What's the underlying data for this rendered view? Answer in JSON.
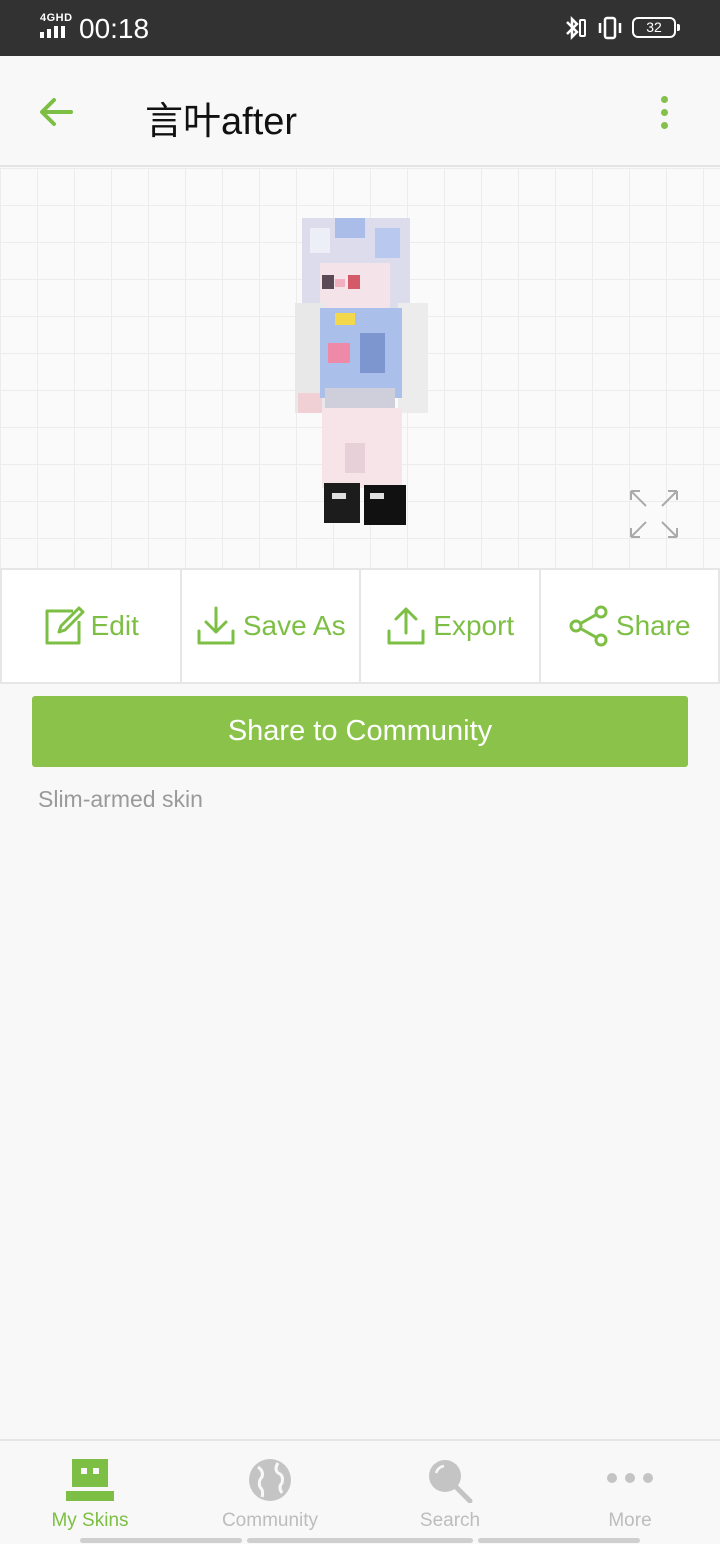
{
  "status_bar": {
    "network": "4GHD",
    "time": "00:18",
    "battery": "32",
    "icons": [
      "signal-icon",
      "bluetooth-icon",
      "vibrate-icon",
      "battery-icon"
    ]
  },
  "header": {
    "title": "言叶after",
    "back_icon": "arrow-left-icon",
    "menu_icon": "more-vertical-icon"
  },
  "preview": {
    "expand_icon": "expand-icon"
  },
  "actions": [
    {
      "label": "Edit",
      "icon": "edit-icon"
    },
    {
      "label": "Save As",
      "icon": "download-icon"
    },
    {
      "label": "Export",
      "icon": "upload-icon"
    },
    {
      "label": "Share",
      "icon": "share-icon"
    }
  ],
  "share_community_label": "Share to Community",
  "skin_type": "Slim-armed skin",
  "bottom_nav": [
    {
      "label": "My Skins",
      "icon": "skin-icon",
      "active": true
    },
    {
      "label": "Community",
      "icon": "globe-icon",
      "active": false
    },
    {
      "label": "Search",
      "icon": "search-icon",
      "active": false
    },
    {
      "label": "More",
      "icon": "more-horizontal-icon",
      "active": false
    }
  ],
  "colors": {
    "accent": "#8bc34a",
    "accent_text": "#7cbf44",
    "status_bar_bg": "#323232",
    "inactive": "#bdbdbd"
  }
}
